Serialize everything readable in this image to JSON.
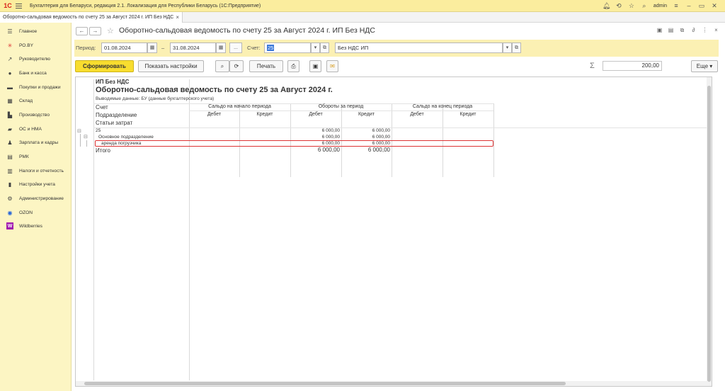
{
  "app": {
    "title": "Бухгалтерия для Беларуси, редакция 2.1. Локализация для Республики Беларусь   (1С:Предприятие)",
    "user": "admin"
  },
  "tab": {
    "label": "Оборотно-сальдовая ведомость по счету 25 за Август 2024 г. ИП Без НДС"
  },
  "sidebar": {
    "items": [
      {
        "label": "Главное",
        "icon": "menu-icon"
      },
      {
        "label": "РО.BY",
        "icon": "ro-by-icon"
      },
      {
        "label": "Руководителю",
        "icon": "chart-icon"
      },
      {
        "label": "Банк и касса",
        "icon": "bank-icon"
      },
      {
        "label": "Покупки и продажи",
        "icon": "cart-icon"
      },
      {
        "label": "Склад",
        "icon": "warehouse-icon"
      },
      {
        "label": "Производство",
        "icon": "factory-icon"
      },
      {
        "label": "ОС и НМА",
        "icon": "truck-icon"
      },
      {
        "label": "Зарплата и кадры",
        "icon": "person-icon"
      },
      {
        "label": "РМК",
        "icon": "cash-register-icon"
      },
      {
        "label": "Налоги и отчетность",
        "icon": "tax-icon"
      },
      {
        "label": "Настройки учета",
        "icon": "document-icon"
      },
      {
        "label": "Администрирование",
        "icon": "gear-icon"
      },
      {
        "label": "OZON",
        "icon": "ozon-icon"
      },
      {
        "label": "Wildberries",
        "icon": "wildberries-icon"
      }
    ]
  },
  "form": {
    "title": "Оборотно-сальдовая ведомость по счету 25 за Август 2024 г. ИП Без НДС",
    "period_label": "Период:",
    "date_from": "01.08.2024",
    "date_sep": "–",
    "date_to": "31.08.2024",
    "more_label": "...",
    "account_label": "Счет:",
    "account_value": "25",
    "org_value": "Без НДС ИП",
    "btn_generate": "Сформировать",
    "btn_settings": "Показать настройки",
    "btn_print": "Печать",
    "btn_more": "Еще",
    "sum_value": "200,00"
  },
  "report": {
    "org": "ИП Без НДС",
    "title": "Оборотно-сальдовая ведомость по счету 25 за Август 2024 г.",
    "output_data": "Выводимые данные:  БУ (данные бухгалтерского учета)",
    "row_headers": [
      "Счет",
      "Подразделение",
      "Статьи затрат"
    ],
    "group_headers": [
      "Сальдо на начало периода",
      "Обороты за период",
      "Сальдо на конец периода"
    ],
    "sub_headers": [
      "Дебет",
      "Кредит",
      "Дебет",
      "Кредит",
      "Дебет",
      "Кредит"
    ],
    "rows": [
      {
        "label": "25",
        "turn_debit": "6 000,00",
        "turn_credit": "6 000,00"
      },
      {
        "label": "Основное подразделение",
        "turn_debit": "6 000,00",
        "turn_credit": "6 000,00"
      },
      {
        "label": "аренда погрузчика",
        "turn_debit": "6 000,00",
        "turn_credit": "6 000,00"
      }
    ],
    "total": {
      "label": "Итого",
      "turn_debit": "6 000,00",
      "turn_credit": "6 000,00"
    }
  }
}
